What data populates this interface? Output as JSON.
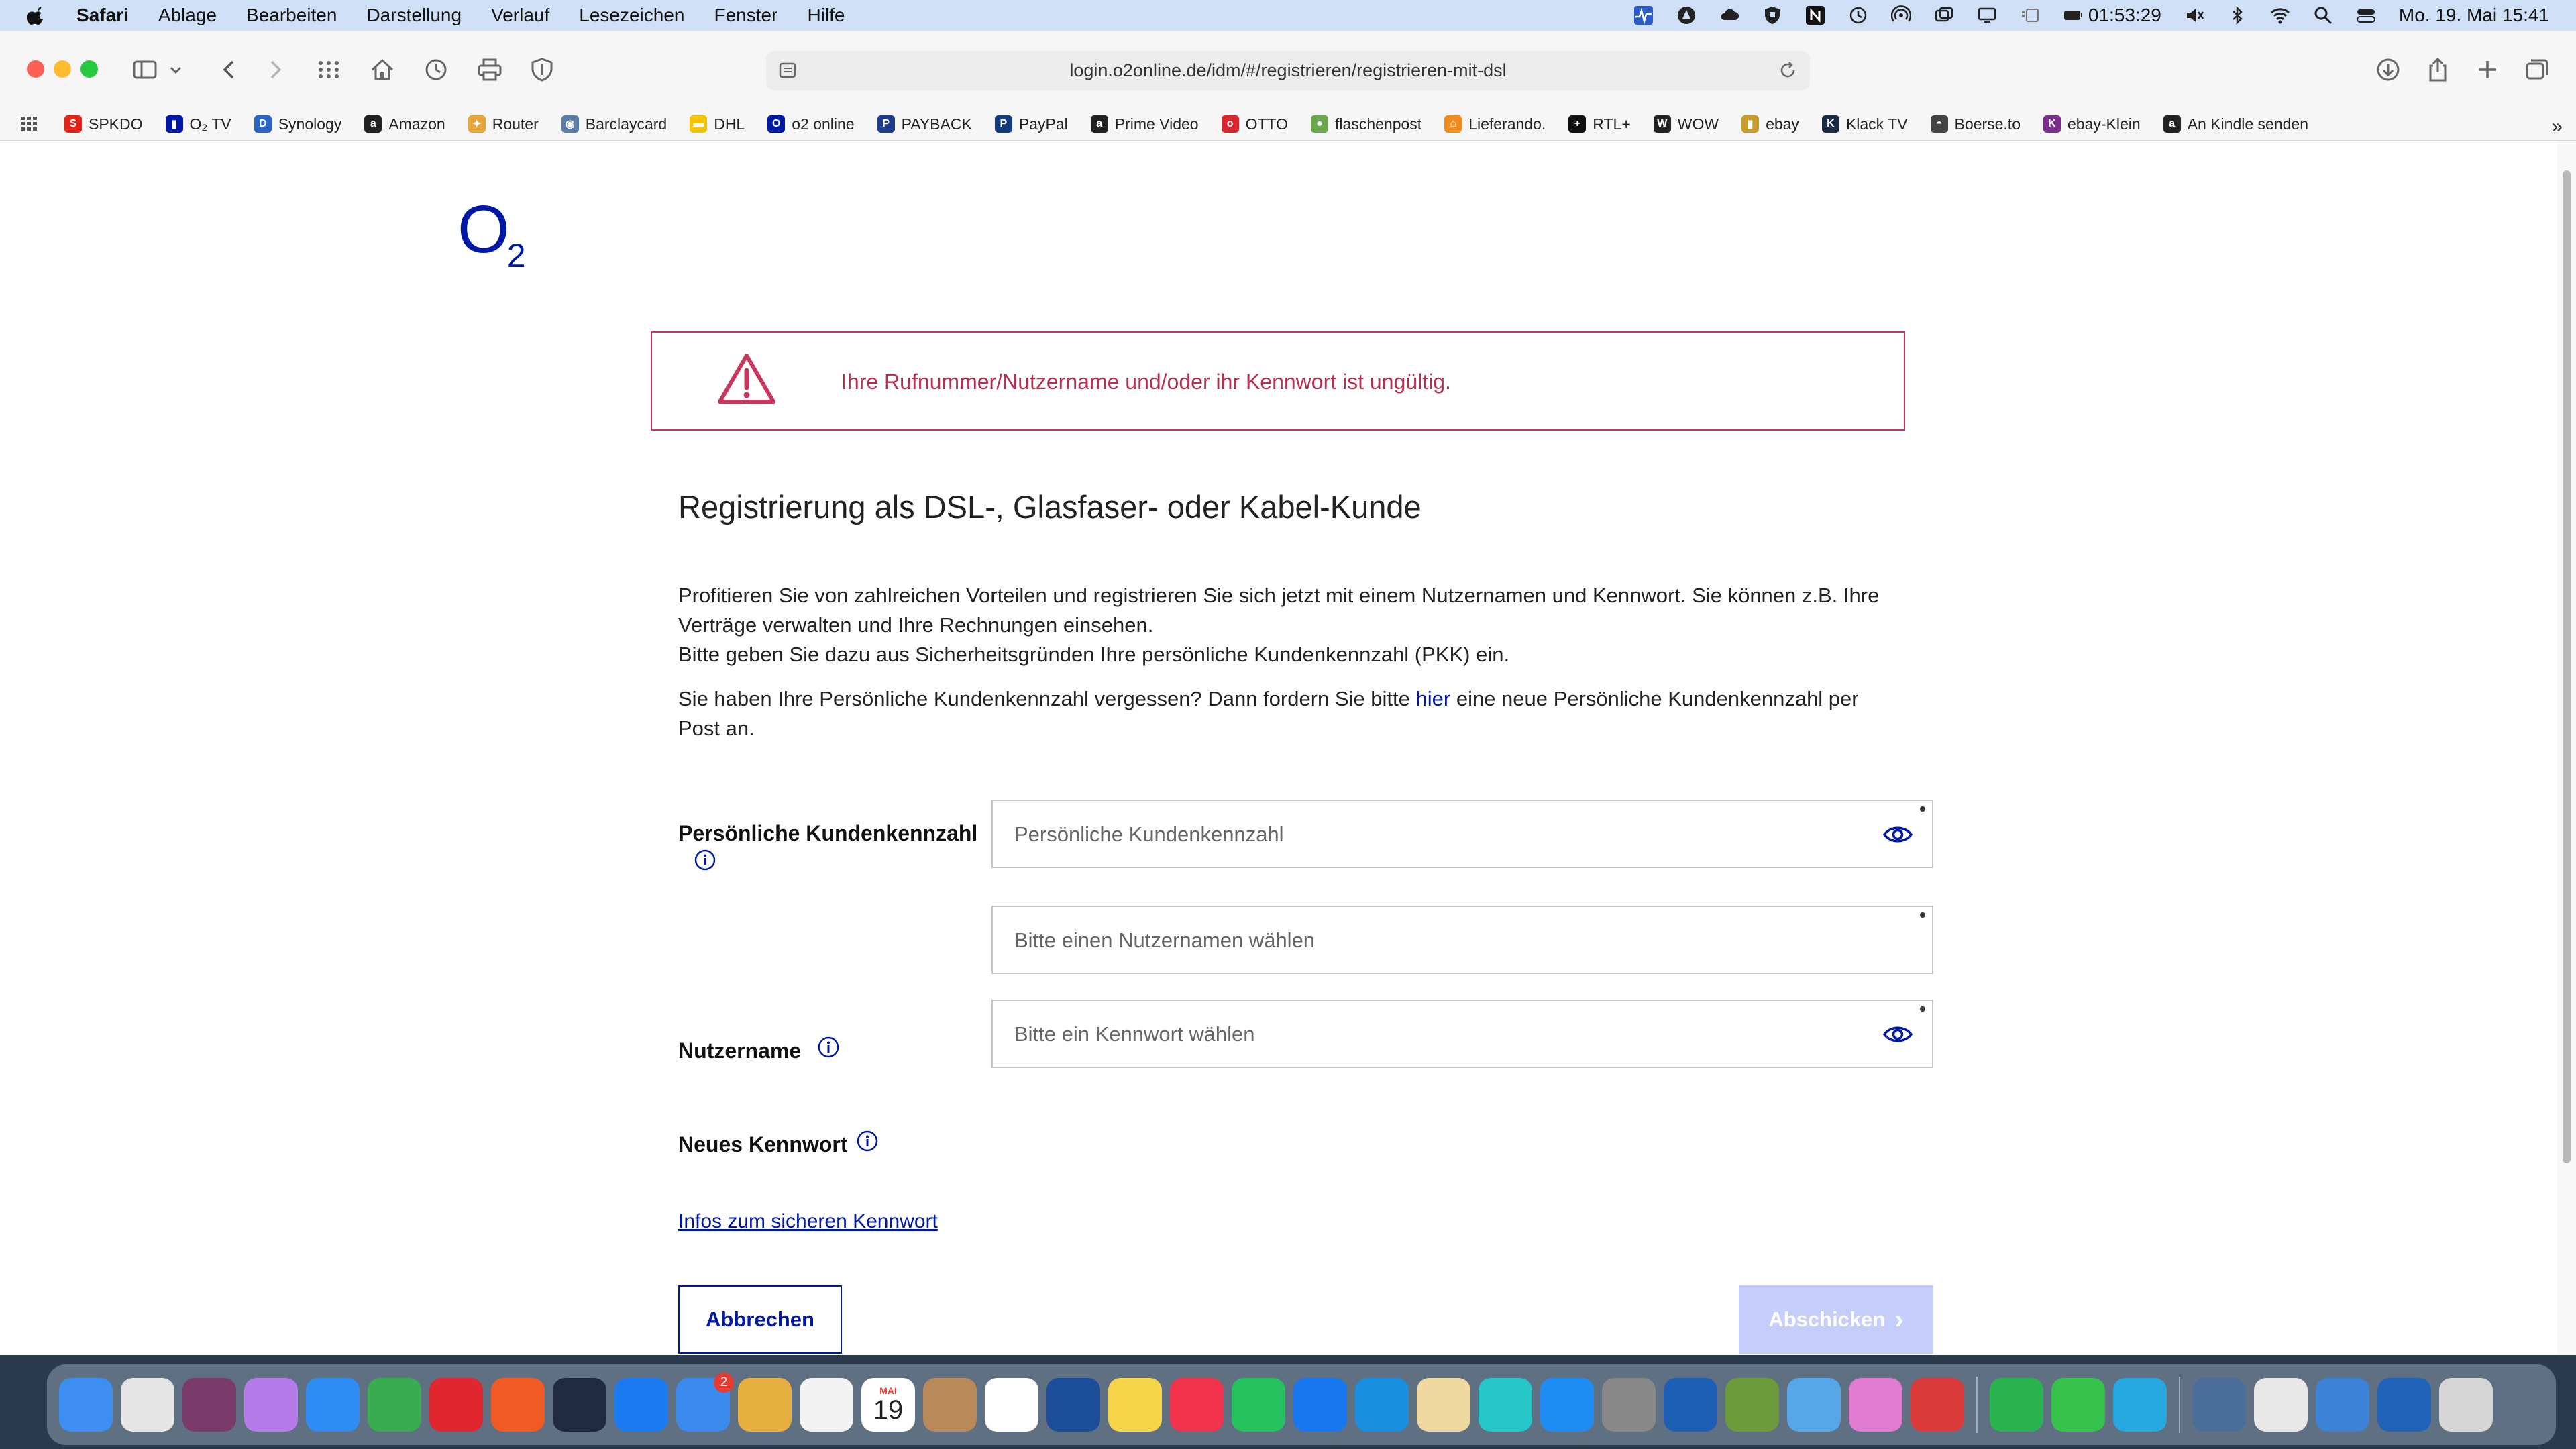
{
  "menubar": {
    "app": "Safari",
    "items": [
      "Ablage",
      "Bearbeiten",
      "Darstellung",
      "Verlauf",
      "Lesezeichen",
      "Fenster",
      "Hilfe"
    ],
    "timer": "01:53:29",
    "clock": "Mo. 19. Mai 15:41"
  },
  "browser": {
    "url": "login.o2online.de/idm/#/registrieren/registrieren-mit-dsl",
    "bookmarks": [
      {
        "label": "SPKDO",
        "color": "#e2231a",
        "glyph": "S"
      },
      {
        "label": "O₂ TV",
        "color": "#0019a5",
        "glyph": "▮"
      },
      {
        "label": "Synology",
        "color": "#2b65c8",
        "glyph": "D"
      },
      {
        "label": "Amazon",
        "color": "#222222",
        "glyph": "a"
      },
      {
        "label": "Router",
        "color": "#e8a33b",
        "glyph": "✦"
      },
      {
        "label": "Barclaycard",
        "color": "#5a7da8",
        "glyph": "◉"
      },
      {
        "label": "DHL",
        "color": "#f5c400",
        "glyph": "▬"
      },
      {
        "label": "o2 online",
        "color": "#0019a5",
        "glyph": "O"
      },
      {
        "label": "PAYBACK",
        "color": "#1e3c8c",
        "glyph": "P"
      },
      {
        "label": "PayPal",
        "color": "#123a7e",
        "glyph": "P"
      },
      {
        "label": "Prime Video",
        "color": "#222222",
        "glyph": "a"
      },
      {
        "label": "OTTO",
        "color": "#d8262f",
        "glyph": "o"
      },
      {
        "label": "flaschenpost",
        "color": "#6aa84f",
        "glyph": "●"
      },
      {
        "label": "Lieferando.",
        "color": "#f28a1e",
        "glyph": "⌂"
      },
      {
        "label": "RTL+",
        "color": "#111111",
        "glyph": "+"
      },
      {
        "label": "WOW",
        "color": "#222222",
        "glyph": "W"
      },
      {
        "label": "ebay",
        "color": "#c79a2a",
        "glyph": "▮"
      },
      {
        "label": "Klack TV",
        "color": "#1b2a44",
        "glyph": "K"
      },
      {
        "label": "Boerse.to",
        "color": "#444444",
        "glyph": "◓"
      },
      {
        "label": "ebay-Klein",
        "color": "#7b2d8e",
        "glyph": "K"
      },
      {
        "label": "An Kindle senden",
        "color": "#222222",
        "glyph": "a"
      }
    ]
  },
  "page": {
    "logo_main": "O",
    "logo_sub": "2",
    "alert": "Ihre Rufnummer/Nutzername und/oder ihr Kennwort ist ungültig.",
    "heading": "Registrierung als DSL-, Glasfaser- oder Kabel-Kunde",
    "intro": "Profitieren Sie von zahlreichen Vorteilen und registrieren Sie sich jetzt mit einem Nutzernamen und Kennwort. Sie können z.B. Ihre Verträge verwalten und Ihre Rechnungen einsehen.",
    "pkk_notice": "Bitte geben Sie dazu aus Sicherheitsgründen Ihre persönliche Kundenkennzahl (PKK) ein.",
    "forgot_before": "Sie haben Ihre Persönliche Kundenkennzahl vergessen? Dann fordern Sie bitte ",
    "forgot_link": "hier",
    "forgot_after": " eine neue Persönliche Kundenkennzahl per Post an.",
    "fields": {
      "pkk": {
        "label": "Persönliche Kundenkennzahl",
        "placeholder": "Persönliche Kundenkennzahl",
        "value": ""
      },
      "username": {
        "label": "Nutzername",
        "placeholder": "Bitte einen Nutzernamen wählen",
        "value": ""
      },
      "password": {
        "label": "Neues Kennwort",
        "placeholder": "Bitte ein Kennwort wählen",
        "value": ""
      }
    },
    "password_info_link": "Infos zum sicheren Kennwort",
    "cancel_label": "Abbrechen",
    "submit_label": "Abschicken",
    "submit_chevron": "›"
  },
  "dock": {
    "mail_badge": "2",
    "calendar_month": "MAI",
    "calendar_day": "19",
    "icons": [
      {
        "name": "finder-icon",
        "color": "#3d8ef0"
      },
      {
        "name": "launchpad-icon",
        "color": "#e6e6e6"
      },
      {
        "name": "stocks-app-icon",
        "color": "#7a3a6a"
      },
      {
        "name": "podcasts-icon",
        "color": "#b57be8"
      },
      {
        "name": "safari-icon",
        "color": "#2f8cf2"
      },
      {
        "name": "chrome-icon",
        "color": "#3bab52"
      },
      {
        "name": "opera-icon",
        "color": "#e0262f"
      },
      {
        "name": "brave-icon",
        "color": "#f05a24"
      },
      {
        "name": "wordpress-icon",
        "color": "#1f2a3c"
      },
      {
        "name": "tasks-icon",
        "color": "#1c7bf0"
      },
      {
        "name": "mail-icon",
        "color": "#3b8bef"
      },
      {
        "name": "recycle-icon",
        "color": "#e6b040"
      },
      {
        "name": "photos-icon",
        "color": "#f3f3f3"
      },
      {
        "name": "calendar-icon",
        "color": "#ffffff"
      },
      {
        "name": "contacts-icon",
        "color": "#b88a5a"
      },
      {
        "name": "reminders-icon",
        "color": "#ffffff"
      },
      {
        "name": "remote-desktop-icon",
        "color": "#1d4e9a"
      },
      {
        "name": "notes-icon",
        "color": "#f7d54a"
      },
      {
        "name": "music-icon",
        "color": "#f2334d"
      },
      {
        "name": "whatsapp-icon",
        "color": "#25c15e"
      },
      {
        "name": "shazam-icon",
        "color": "#1677ee"
      },
      {
        "name": "prime-video-icon",
        "color": "#1a8fe0"
      },
      {
        "name": "scripts-icon",
        "color": "#f0d9a0"
      },
      {
        "name": "amazon-music-icon",
        "color": "#26c6c8"
      },
      {
        "name": "app-store-icon",
        "color": "#1f8cf4"
      },
      {
        "name": "system-settings-icon",
        "color": "#888888"
      },
      {
        "name": "activity-monitor-icon",
        "color": "#1c5fb5"
      },
      {
        "name": "tor-icon",
        "color": "#6c9a3c"
      },
      {
        "name": "maps-pin-icon",
        "color": "#57a7e8"
      },
      {
        "name": "folder-pink-icon",
        "color": "#e07bd2"
      },
      {
        "name": "toolbox-icon",
        "color": "#d93a3a"
      },
      {
        "name": "find-my-icon",
        "color": "#2bb34f"
      },
      {
        "name": "facetime-icon",
        "color": "#37c14d"
      },
      {
        "name": "globe-icon",
        "color": "#28a8e0"
      },
      {
        "name": "preview-icon",
        "color": "#4a6d9a"
      },
      {
        "name": "documents-icon",
        "color": "#e8e8e8"
      },
      {
        "name": "windows-folder-icon",
        "color": "#3c82d6"
      },
      {
        "name": "activity-chart-icon",
        "color": "#2163b8"
      },
      {
        "name": "trash-icon",
        "color": "#d6d6d6"
      }
    ]
  }
}
